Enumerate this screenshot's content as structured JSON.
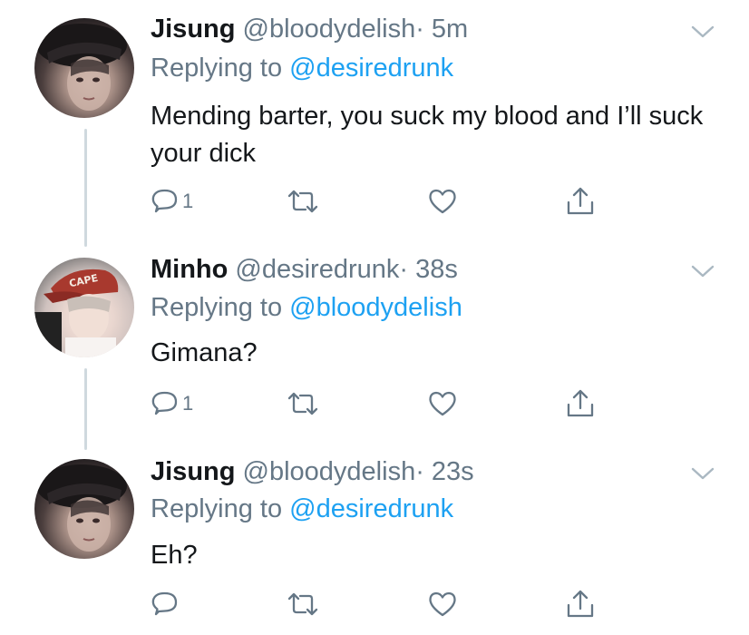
{
  "tweets": [
    {
      "name": "Jisung",
      "handle": "@bloodydelish",
      "time": "· 5m",
      "replying_prefix": "Replying to",
      "replying_to": "@desiredrunk",
      "text": "Mending barter, you suck my blood and I’ll suck your dick",
      "reply_count": "1",
      "avatar": "jisung-avatar"
    },
    {
      "name": "Minho",
      "handle": "@desiredrunk",
      "time": "· 38s",
      "replying_prefix": "Replying to",
      "replying_to": "@bloodydelish",
      "text": "Gimana?",
      "reply_count": "1",
      "avatar": "minho-avatar"
    },
    {
      "name": "Jisung",
      "handle": "@bloodydelish",
      "time": "· 23s",
      "replying_prefix": "Replying to",
      "replying_to": "@desiredrunk",
      "text": "Eh?",
      "reply_count": "",
      "avatar": "jisung-avatar"
    }
  ],
  "icons": {
    "reply": "reply-icon",
    "retweet": "retweet-icon",
    "like": "heart-icon",
    "share": "share-icon",
    "more": "chevron-down-icon"
  },
  "colors": {
    "name": "#14171a",
    "meta": "#657786",
    "mention": "#1da1f2",
    "thread_line": "#cfd9de"
  }
}
